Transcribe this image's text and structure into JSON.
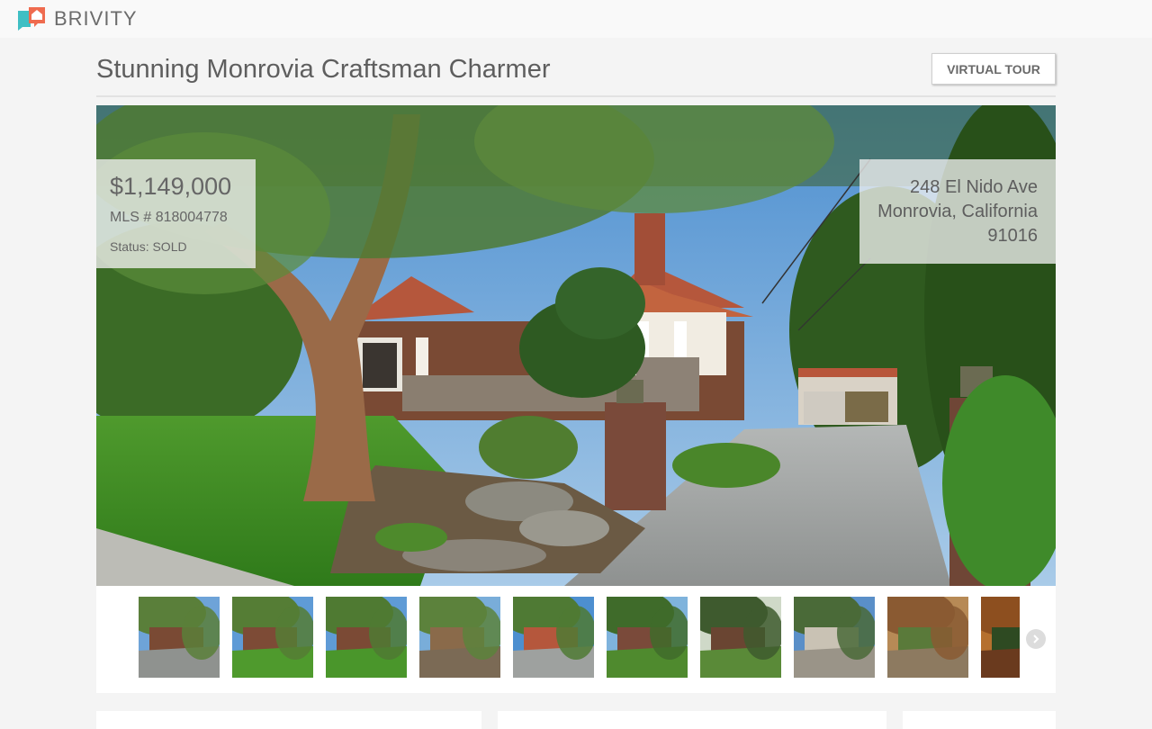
{
  "app": {
    "brand": "BRIVITY",
    "brand_colors": {
      "coral": "#ef6b4f",
      "teal": "#3fbfc4"
    }
  },
  "listing": {
    "title": "Stunning Monrovia Craftsman Charmer",
    "virtual_tour_label": "VIRTUAL TOUR",
    "price": "$1,149,000",
    "mls": "MLS # 818004778",
    "status": "Status: SOLD",
    "address": {
      "street": "248 El Nido Ave",
      "city_state": "Monrovia, California",
      "zip": "91016"
    }
  },
  "gallery": {
    "thumbnails": [
      {
        "scene": "front-tree-driveway"
      },
      {
        "scene": "front-lawn-wide"
      },
      {
        "scene": "front-lawn-garden"
      },
      {
        "scene": "tree-rock-garden"
      },
      {
        "scene": "house-driveway-angle"
      },
      {
        "scene": "stone-porch-closeup"
      },
      {
        "scene": "porch-facade"
      },
      {
        "scene": "front-steps-door"
      },
      {
        "scene": "covered-porch-seating"
      },
      {
        "scene": "wood-ceiling-lantern"
      }
    ],
    "next_icon": "chevron-right-icon"
  }
}
